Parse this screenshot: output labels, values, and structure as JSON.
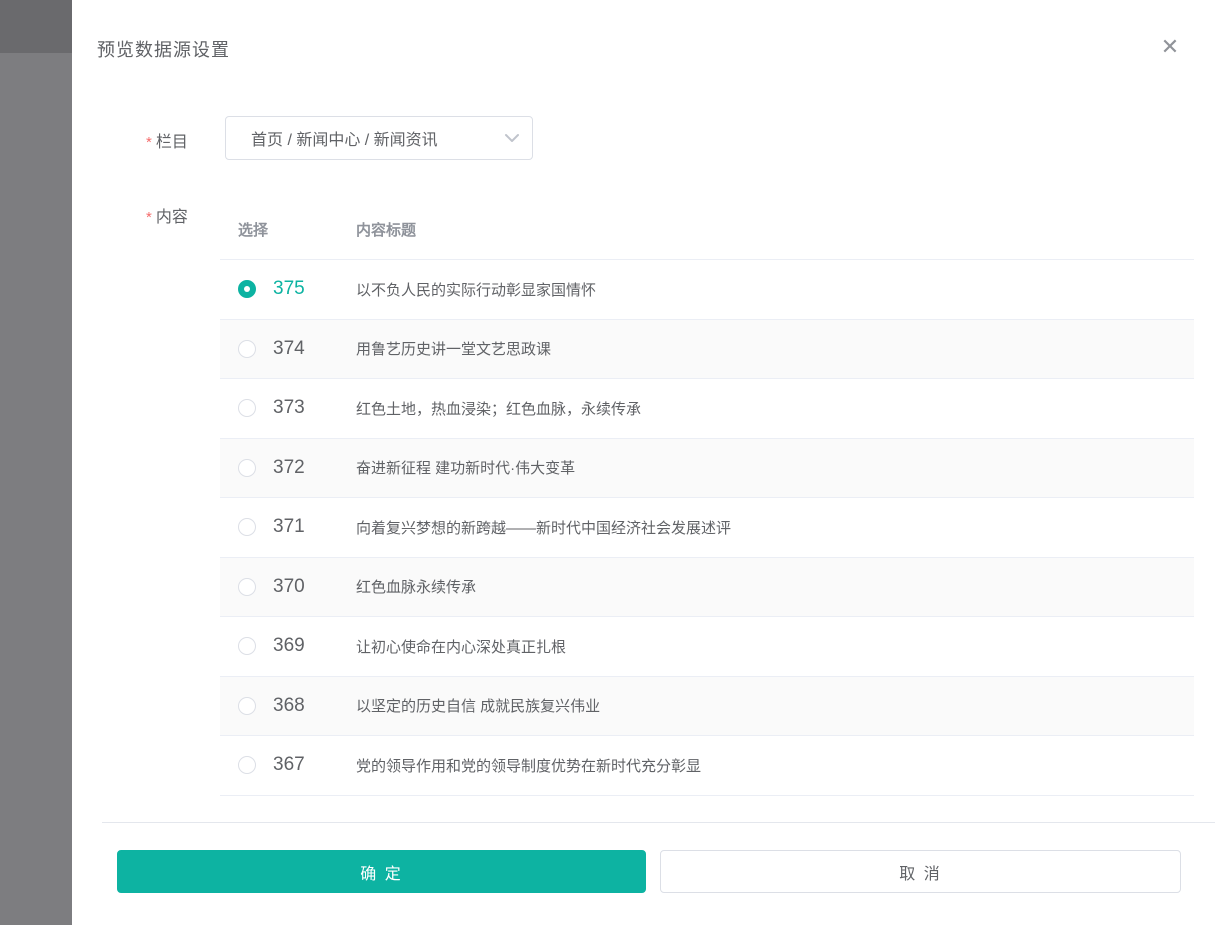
{
  "modal": {
    "title": "预览数据源设置",
    "close_icon": "✕"
  },
  "form": {
    "column_field": {
      "required_mark": "*",
      "label": "栏目",
      "value": "首页 / 新闻中心 / 新闻资讯"
    },
    "content_field": {
      "required_mark": "*",
      "label": "内容"
    }
  },
  "table": {
    "headers": [
      "选择",
      "内容标题"
    ],
    "rows": [
      {
        "id": "375",
        "title": "以不负人民的实际行动彰显家国情怀",
        "selected": true
      },
      {
        "id": "374",
        "title": "用鲁艺历史讲一堂文艺思政课",
        "selected": false
      },
      {
        "id": "373",
        "title": "红色土地，热血浸染；红色血脉，永续传承",
        "selected": false
      },
      {
        "id": "372",
        "title": "奋进新征程 建功新时代·伟大变革",
        "selected": false
      },
      {
        "id": "371",
        "title": "向着复兴梦想的新跨越——新时代中国经济社会发展述评",
        "selected": false
      },
      {
        "id": "370",
        "title": "红色血脉永续传承",
        "selected": false
      },
      {
        "id": "369",
        "title": "让初心使命在内心深处真正扎根",
        "selected": false
      },
      {
        "id": "368",
        "title": "以坚定的历史自信 成就民族复兴伟业",
        "selected": false
      },
      {
        "id": "367",
        "title": "党的领导作用和党的领导制度优势在新时代充分彰显",
        "selected": false
      }
    ]
  },
  "footer": {
    "confirm_label": "确 定",
    "cancel_label": "取 消"
  },
  "colors": {
    "accent": "#0db3a2",
    "required_mark": "#f56c6c",
    "border": "#dcdfe6",
    "row_alt_background": "#fafafa",
    "row_border": "#ebeef5"
  }
}
